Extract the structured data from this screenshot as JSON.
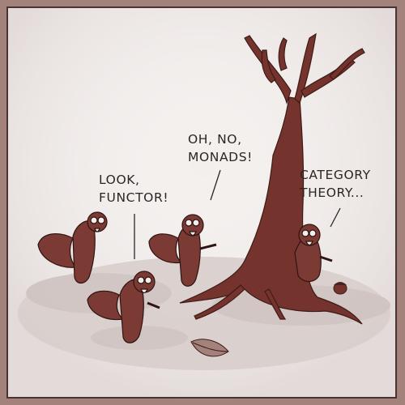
{
  "captions": {
    "functor": {
      "line1": "LOOK,",
      "line2": "FUNCTOR!"
    },
    "monads": {
      "line1": "OH, NO,",
      "line2": "MONADS!"
    },
    "category": {
      "line1": "CATEGORY",
      "line2": "THEORY..."
    }
  },
  "colors": {
    "border": "#a3827b",
    "paper": "#f3efed",
    "ink": "#4a2320",
    "squirrel": "#7b3a34",
    "tree": "#74332c"
  }
}
